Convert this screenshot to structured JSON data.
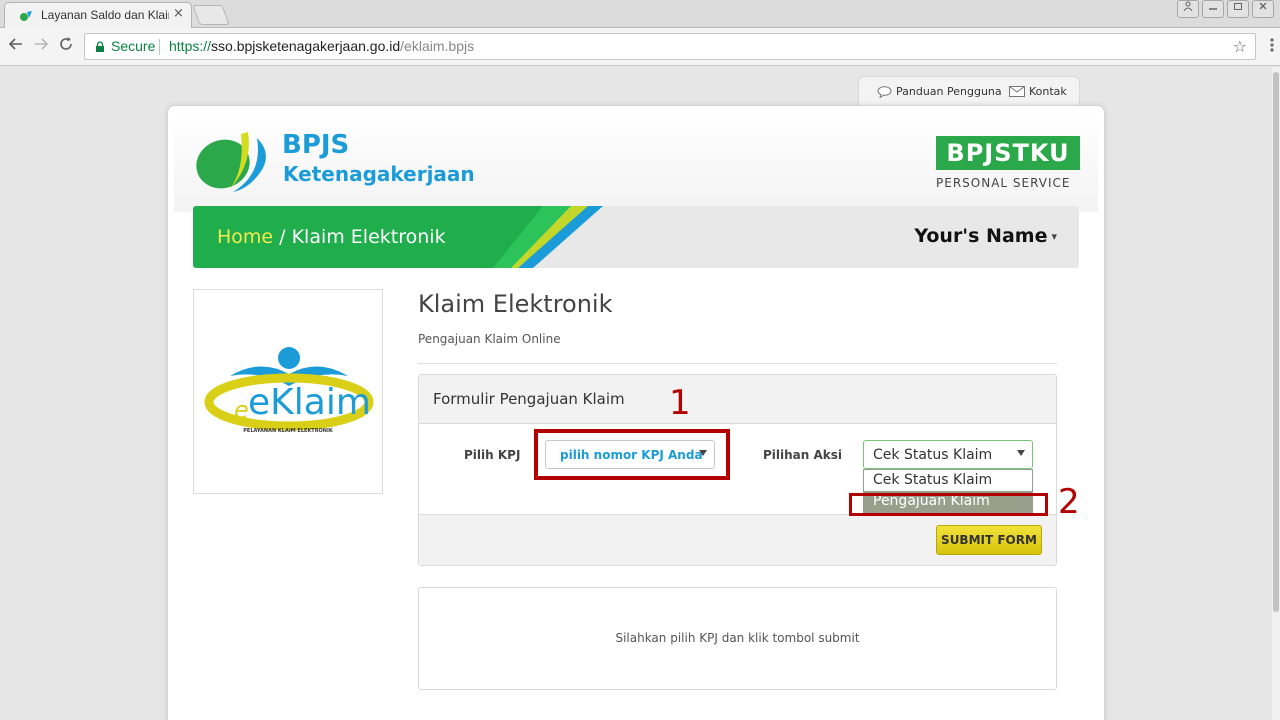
{
  "browser": {
    "tab_title": "Layanan Saldo dan Klaim",
    "tab_close": "×",
    "secure_label": "Secure",
    "url_scheme": "https://",
    "url_host": "sso.bpjsketenagakerjaan.go.id",
    "url_path": "/eklaim.bpjs",
    "star": "☆"
  },
  "utility": {
    "guide_label": "Panduan Pengguna",
    "contact_label": "Kontak"
  },
  "header": {
    "brand_name": "BPJS",
    "brand_sub": "Ketenagakerjaan",
    "tku_label": "BPJSTKU",
    "tku_sub": "PERSONAL SERVICE"
  },
  "breadcrumb": {
    "home": "Home",
    "separator": " / ",
    "current": "Klaim Elektronik",
    "user": "Your's Name",
    "user_caret": "▾"
  },
  "sidebar": {
    "eklaim_label": "eKlaim",
    "eklaim_sub": "PELAYANAN KLAIM ELEKTRONIK"
  },
  "main": {
    "title": "Klaim Elektronik",
    "subtitle": "Pengajuan Klaim Online",
    "form_title": "Formulir Pengajuan Klaim",
    "kpj_label": "Pilih KPJ",
    "kpj_value": "pilih nomor KPJ Anda",
    "aksi_label": "Pilihan Aksi",
    "aksi_value": "Cek Status Klaim",
    "aksi_options": [
      "Cek Status Klaim",
      "Pengajuan Klaim"
    ],
    "submit_label": "SUBMIT FORM",
    "result_text": "Silahkan pilih KPJ dan klik tombol submit"
  },
  "annotations": {
    "one": "1",
    "two": "2"
  },
  "colors": {
    "brand_blue": "#1b9cd8",
    "brand_green": "#2aa84a",
    "annotation_red": "#b30000",
    "submit_yellow": "#e6d31f"
  }
}
